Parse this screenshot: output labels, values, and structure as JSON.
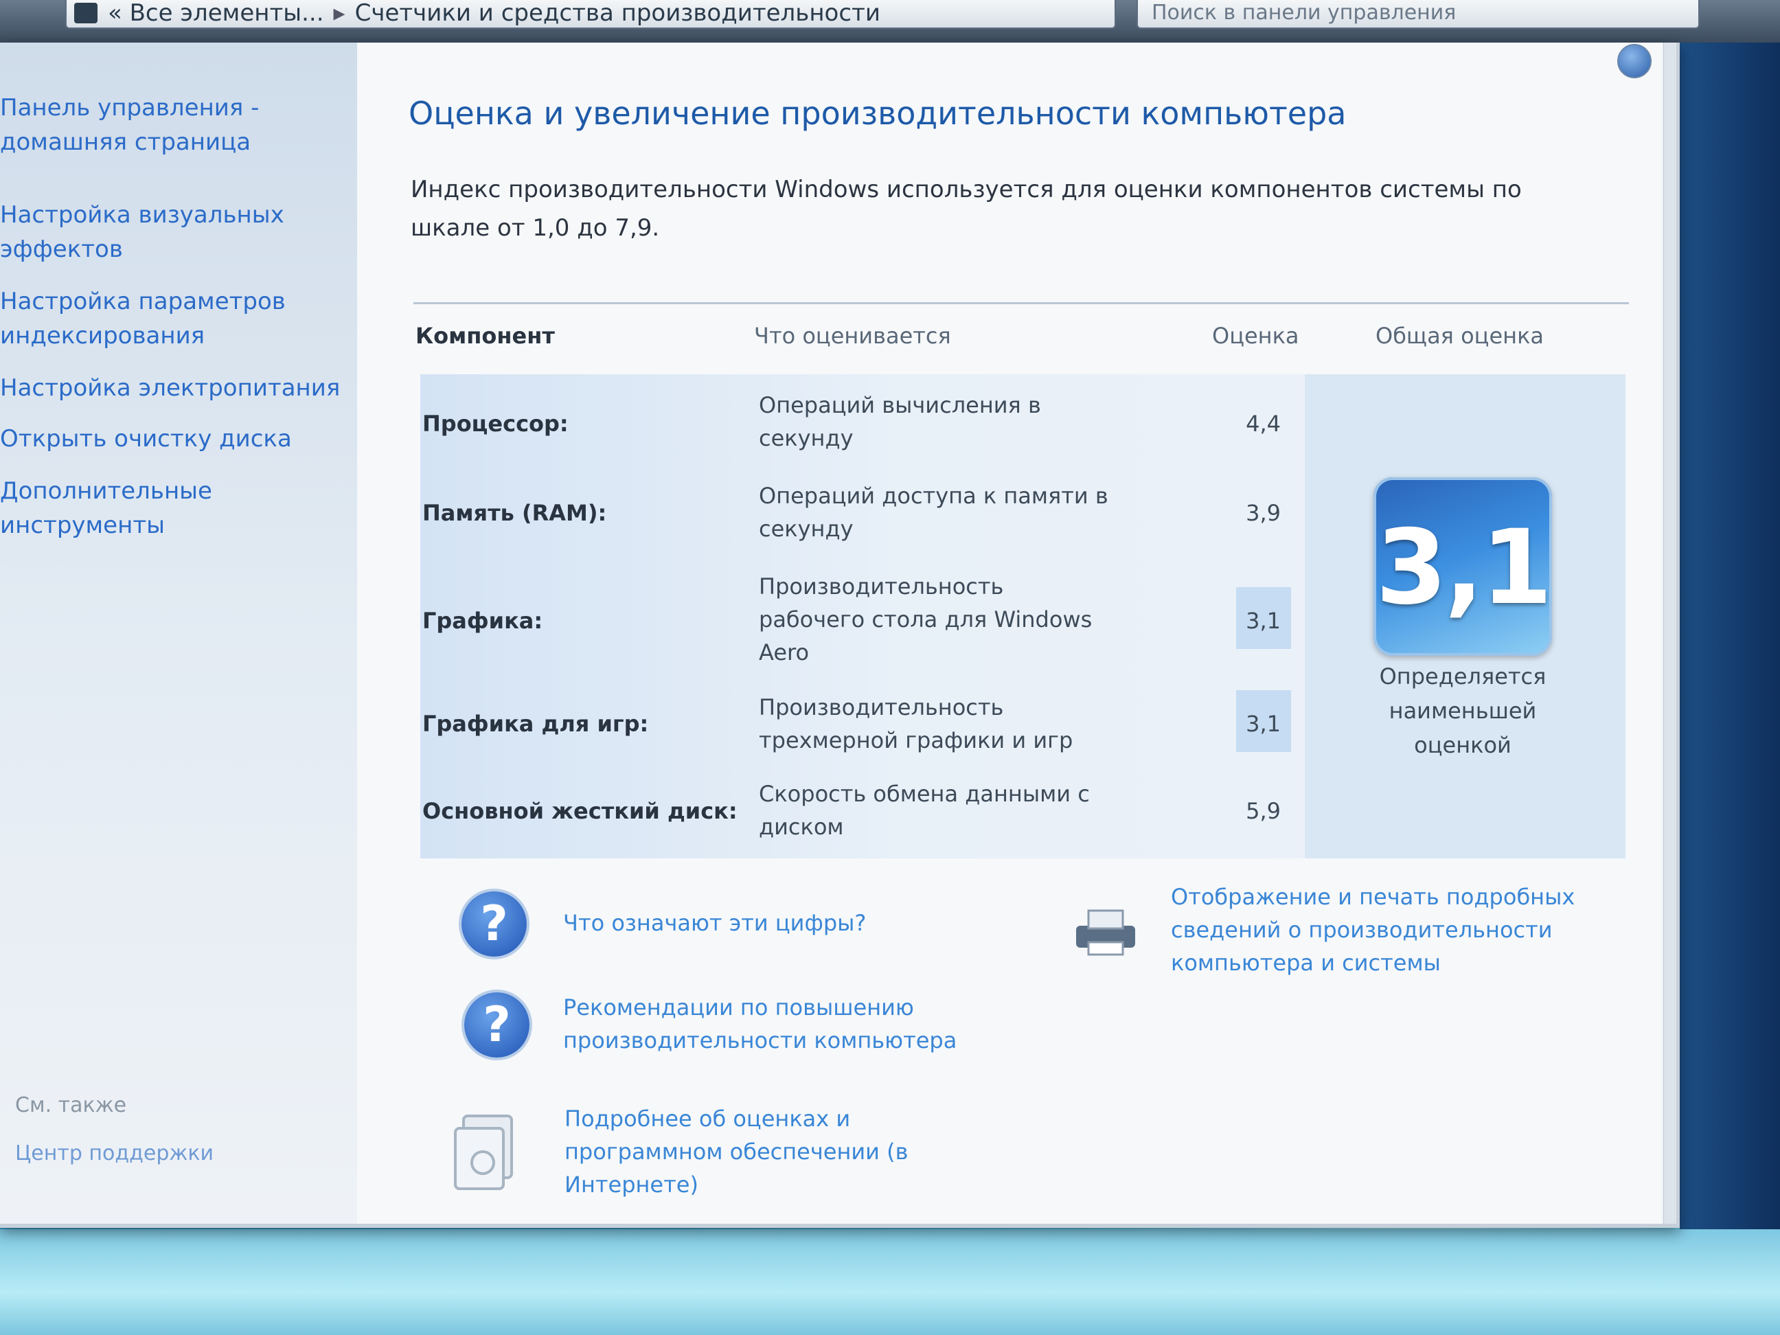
{
  "topbar": {
    "breadcrumb_1": "« Все элементы...",
    "breadcrumb_2": "Счетчики и средства производительности",
    "search_placeholder": "Поиск в панели управления"
  },
  "sidebar": {
    "items": [
      {
        "label": "Панель управления -\nдомашняя страница"
      },
      {
        "label": "Настройка визуальных\nэффектов"
      },
      {
        "label": "Настройка параметров\nиндексирования"
      },
      {
        "label": "Настройка электропитания"
      },
      {
        "label": "Открыть очистку диска"
      },
      {
        "label": "Дополнительные\nинструменты"
      }
    ],
    "see_also": "См. также",
    "support_center": "Центр поддержки"
  },
  "main": {
    "title": "Оценка и увеличение производительности компьютера",
    "description": "Индекс производительности Windows используется для оценки компонентов системы по шкале от 1,0 до 7,9.",
    "table": {
      "headers": {
        "component": "Компонент",
        "what": "Что оценивается",
        "score": "Оценка",
        "overall": "Общая оценка"
      },
      "rows": [
        {
          "name": "Процессор:",
          "what": "Операций вычисления в секунду",
          "score": "4,4"
        },
        {
          "name": "Память (RAM):",
          "what": "Операций доступа к памяти в секунду",
          "score": "3,9"
        },
        {
          "name": "Графика:",
          "what": "Производительность рабочего стола для Windows Aero",
          "score": "3,1"
        },
        {
          "name": "Графика для игр:",
          "what": "Производительность трехмерной графики и игр",
          "score": "3,1"
        },
        {
          "name": "Основной жесткий диск:",
          "what": "Скорость обмена данными с диском",
          "score": "5,9"
        }
      ],
      "overall_score": "3,1",
      "overall_caption": "Определяется наименьшей оценкой"
    },
    "links": {
      "what_numbers_mean": "Что означают эти цифры?",
      "recommendations": "Рекомендации по повышению производительности компьютера",
      "more_online": "Подробнее об оценках и программном обеспечении (в Интернете)",
      "print_details": "Отображение и печать подробных сведений о производительности компьютера и системы"
    }
  },
  "colors": {
    "link": "#3a86d6",
    "title": "#1e5aa8",
    "badge": "#2a64b8"
  }
}
